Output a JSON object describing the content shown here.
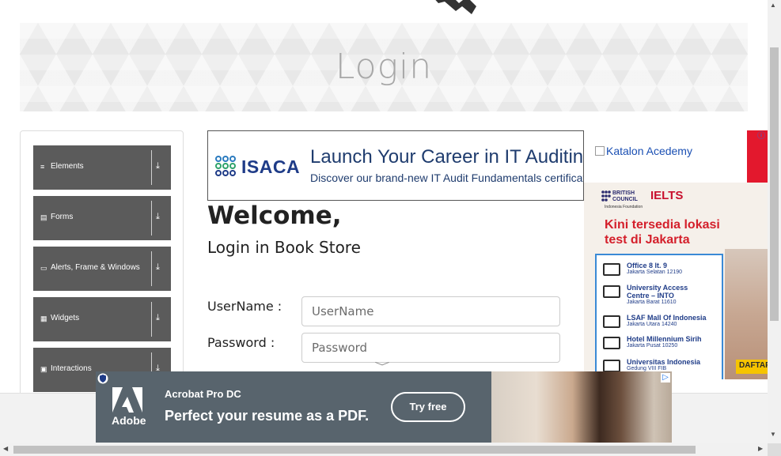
{
  "banner": {
    "title": "Login"
  },
  "sidebar": {
    "items": [
      {
        "label": "Elements",
        "icon": "list-icon"
      },
      {
        "label": "Forms",
        "icon": "form-icon"
      },
      {
        "label": "Alerts, Frame & Windows",
        "icon": "window-icon"
      },
      {
        "label": "Widgets",
        "icon": "grid-icon"
      },
      {
        "label": "Interactions",
        "icon": "interactions-icon"
      }
    ],
    "arrow": "⤓"
  },
  "ads": {
    "isaca": {
      "logo": "ISACA",
      "headline": "Launch Your Career in IT Auditing",
      "subline": "Discover our brand-new IT Audit Fundamentals certificate"
    },
    "side": {
      "katalon_alt": "Katalon Acedemy",
      "bc_line1": "BRITISH",
      "bc_line2": "COUNCIL",
      "ielts_logo": "IELTS",
      "foundation": "Indonesia Foundation",
      "headline_line1": "Kini tersedia lokasi",
      "headline_line2": "test di Jakarta",
      "locations": [
        {
          "name": "Office 8 lt. 9",
          "address": "Jakarta Selatan 12190"
        },
        {
          "name": "University Access",
          "name2": "Centre – INTO",
          "address": "Jakarta Barat 11610"
        },
        {
          "name": "LSAF Mall Of Indonesia",
          "address": "Jakarta Utara 14240"
        },
        {
          "name": "Hotel Millennium Sirih",
          "address": "Jakarta Pusat 10250"
        },
        {
          "name": "Universitas Indonesia",
          "address": "Gedung VIII FIB"
        }
      ],
      "cta": "DAFTAR"
    },
    "adobe": {
      "brand": "Adobe",
      "product": "Acrobat Pro DC",
      "tagline": "Perfect your resume as a PDF.",
      "button": "Try free"
    }
  },
  "login": {
    "welcome": "Welcome,",
    "subtitle": "Login in Book Store",
    "username_label": "UserName :",
    "username_placeholder": "UserName",
    "password_label": "Password :",
    "password_placeholder": "Password"
  },
  "colors": {
    "menu_bg": "#5b5b5b",
    "banner_title": "#a7a7a7",
    "isaca_blue": "#1f3c88",
    "ielts_red": "#d41f2b",
    "adobe_bg": "#58646d"
  }
}
